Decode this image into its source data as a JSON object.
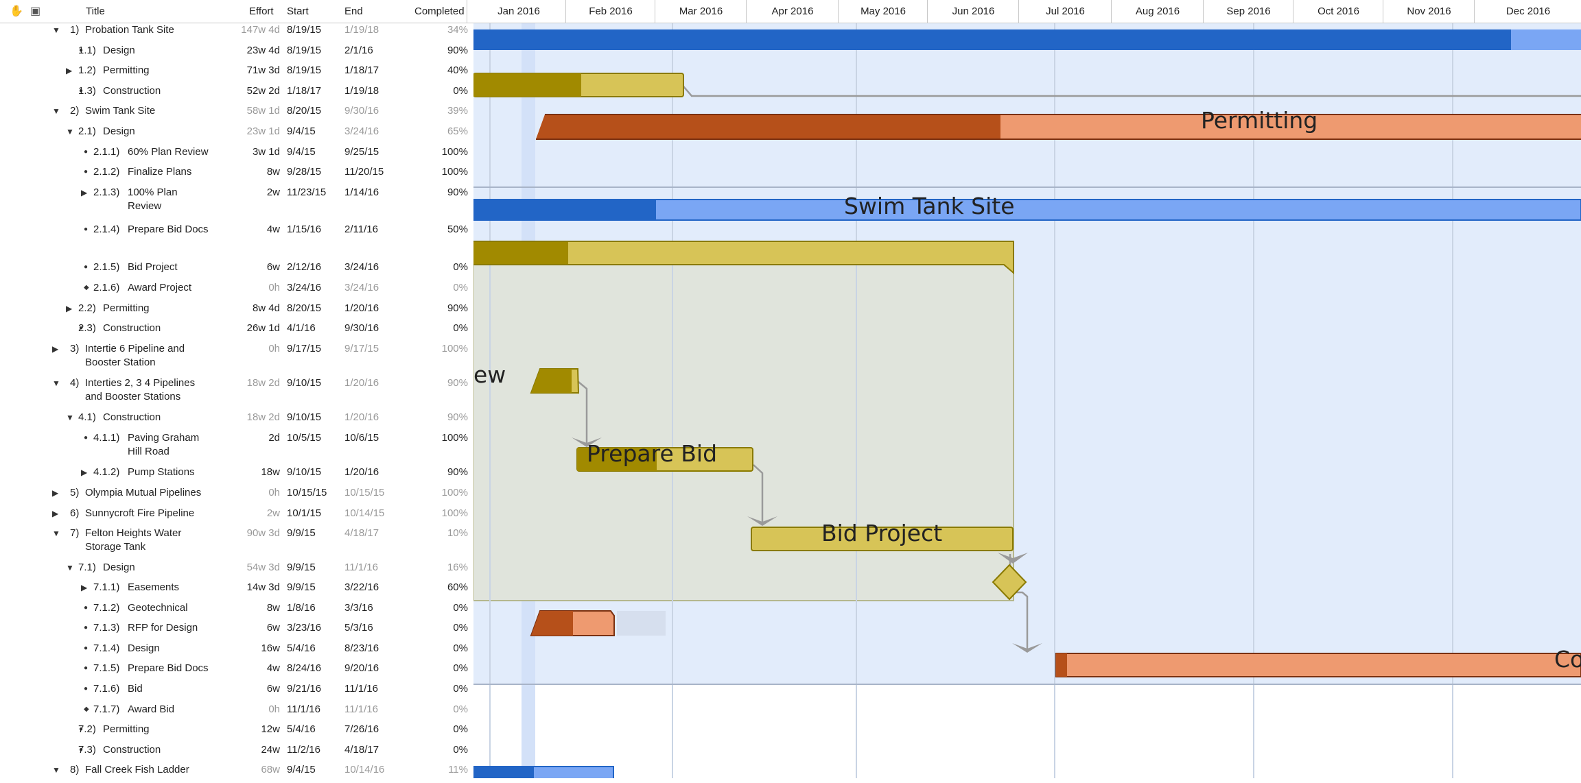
{
  "toolbar": {
    "hand_icon": "✋",
    "grid_icon": "▣"
  },
  "columns": {
    "title": "Title",
    "effort": "Effort",
    "start": "Start",
    "end": "End",
    "completed": "Completed"
  },
  "months": [
    "Jan 2016",
    "Feb 2016",
    "Mar 2016",
    "Apr 2016",
    "May 2016",
    "Jun 2016",
    "Jul 2016",
    "Aug 2016",
    "Sep 2016",
    "Oct 2016",
    "Nov 2016",
    "Dec 2016"
  ],
  "rows": [
    {
      "level": 0,
      "marker": "open",
      "num": "1)",
      "title": "Probation Tank Site",
      "effort": "147w 4d",
      "start": "8/19/15",
      "end": "1/19/18",
      "completed": "34%",
      "dim": true
    },
    {
      "level": 1,
      "marker": "bullet",
      "num": "1.1)",
      "title": "Design",
      "effort": "23w 4d",
      "start": "8/19/15",
      "end": "2/1/16",
      "completed": "90%"
    },
    {
      "level": 1,
      "marker": "closed",
      "num": "1.2)",
      "title": "Permitting",
      "effort": "71w 3d",
      "start": "8/19/15",
      "end": "1/18/17",
      "completed": "40%"
    },
    {
      "level": 1,
      "marker": "bullet",
      "num": "1.3)",
      "title": "Construction",
      "effort": "52w 2d",
      "start": "1/18/17",
      "end": "1/19/18",
      "completed": "0%"
    },
    {
      "level": 0,
      "marker": "open",
      "num": "2)",
      "title": "Swim Tank Site",
      "effort": "58w 1d",
      "start": "8/20/15",
      "end": "9/30/16",
      "completed": "39%",
      "dim": true
    },
    {
      "level": 1,
      "marker": "open",
      "num": "2.1)",
      "title": "Design",
      "effort": "23w 1d",
      "start": "9/4/15",
      "end": "3/24/16",
      "completed": "65%",
      "dim": true
    },
    {
      "level": 2,
      "marker": "bullet",
      "num": "2.1.1)",
      "title": "60% Plan Review",
      "effort": "3w 1d",
      "start": "9/4/15",
      "end": "9/25/15",
      "completed": "100%"
    },
    {
      "level": 2,
      "marker": "bullet",
      "num": "2.1.2)",
      "title": "Finalize Plans",
      "effort": "8w",
      "start": "9/28/15",
      "end": "11/20/15",
      "completed": "100%"
    },
    {
      "level": 2,
      "marker": "closed",
      "num": "2.1.3)",
      "title": "100% Plan Review",
      "effort": "2w",
      "start": "11/23/15",
      "end": "1/14/16",
      "completed": "90%",
      "lines": 2
    },
    {
      "level": 2,
      "marker": "bullet",
      "num": "2.1.4)",
      "title": "Prepare Bid Docs",
      "effort": "4w",
      "start": "1/15/16",
      "end": "2/11/16",
      "completed": "50%",
      "lines": 2
    },
    {
      "level": 2,
      "marker": "bullet",
      "num": "2.1.5)",
      "title": "Bid Project",
      "effort": "6w",
      "start": "2/12/16",
      "end": "3/24/16",
      "completed": "0%"
    },
    {
      "level": 2,
      "marker": "diamond",
      "num": "2.1.6)",
      "title": "Award Project",
      "effort": "0h",
      "start": "3/24/16",
      "end": "3/24/16",
      "completed": "0%",
      "dim": true
    },
    {
      "level": 1,
      "marker": "closed",
      "num": "2.2)",
      "title": "Permitting",
      "effort": "8w 4d",
      "start": "8/20/15",
      "end": "1/20/16",
      "completed": "90%"
    },
    {
      "level": 1,
      "marker": "bullet",
      "num": "2.3)",
      "title": "Construction",
      "effort": "26w 1d",
      "start": "4/1/16",
      "end": "9/30/16",
      "completed": "0%"
    },
    {
      "level": 0,
      "marker": "closed",
      "num": "3)",
      "title": "Intertie 6 Pipeline and Booster Station",
      "effort": "0h",
      "start": "9/17/15",
      "end": "9/17/15",
      "completed": "100%",
      "dim": true,
      "lines": 2
    },
    {
      "level": 0,
      "marker": "open",
      "num": "4)",
      "title": "Interties 2, 3 4 Pipelines and Booster Stations",
      "effort": "18w 2d",
      "start": "9/10/15",
      "end": "1/20/16",
      "completed": "90%",
      "dim": true,
      "lines": 2
    },
    {
      "level": 1,
      "marker": "open",
      "num": "4.1)",
      "title": "Construction",
      "effort": "18w 2d",
      "start": "9/10/15",
      "end": "1/20/16",
      "completed": "90%",
      "dim": true
    },
    {
      "level": 2,
      "marker": "bullet",
      "num": "4.1.1)",
      "title": "Paving Graham Hill Road",
      "effort": "2d",
      "start": "10/5/15",
      "end": "10/6/15",
      "completed": "100%",
      "lines": 2
    },
    {
      "level": 2,
      "marker": "closed",
      "num": "4.1.2)",
      "title": "Pump Stations",
      "effort": "18w",
      "start": "9/10/15",
      "end": "1/20/16",
      "completed": "90%"
    },
    {
      "level": 0,
      "marker": "closed",
      "num": "5)",
      "title": "Olympia Mutual Pipelines",
      "effort": "0h",
      "start": "10/15/15",
      "end": "10/15/15",
      "completed": "100%",
      "dim": true
    },
    {
      "level": 0,
      "marker": "closed",
      "num": "6)",
      "title": "Sunnycroft Fire Pipeline",
      "effort": "2w",
      "start": "10/1/15",
      "end": "10/14/15",
      "completed": "100%",
      "dim": true
    },
    {
      "level": 0,
      "marker": "open",
      "num": "7)",
      "title": "Felton Heights Water Storage Tank",
      "effort": "90w 3d",
      "start": "9/9/15",
      "end": "4/18/17",
      "completed": "10%",
      "dim": true,
      "lines": 2
    },
    {
      "level": 1,
      "marker": "open",
      "num": "7.1)",
      "title": "Design",
      "effort": "54w 3d",
      "start": "9/9/15",
      "end": "11/1/16",
      "completed": "16%",
      "dim": true
    },
    {
      "level": 2,
      "marker": "closed",
      "num": "7.1.1)",
      "title": "Easements",
      "effort": "14w 3d",
      "start": "9/9/15",
      "end": "3/22/16",
      "completed": "60%"
    },
    {
      "level": 2,
      "marker": "bullet",
      "num": "7.1.2)",
      "title": "Geotechnical",
      "effort": "8w",
      "start": "1/8/16",
      "end": "3/3/16",
      "completed": "0%"
    },
    {
      "level": 2,
      "marker": "bullet",
      "num": "7.1.3)",
      "title": "RFP for Design",
      "effort": "6w",
      "start": "3/23/16",
      "end": "5/3/16",
      "completed": "0%"
    },
    {
      "level": 2,
      "marker": "bullet",
      "num": "7.1.4)",
      "title": "Design",
      "effort": "16w",
      "start": "5/4/16",
      "end": "8/23/16",
      "completed": "0%"
    },
    {
      "level": 2,
      "marker": "bullet",
      "num": "7.1.5)",
      "title": "Prepare Bid Docs",
      "effort": "4w",
      "start": "8/24/16",
      "end": "9/20/16",
      "completed": "0%"
    },
    {
      "level": 2,
      "marker": "bullet",
      "num": "7.1.6)",
      "title": "Bid",
      "effort": "6w",
      "start": "9/21/16",
      "end": "11/1/16",
      "completed": "0%"
    },
    {
      "level": 2,
      "marker": "diamond",
      "num": "7.1.7)",
      "title": "Award Bid",
      "effort": "0h",
      "start": "11/1/16",
      "end": "11/1/16",
      "completed": "0%",
      "dim": true
    },
    {
      "level": 1,
      "marker": "bullet",
      "num": "7.2)",
      "title": "Permitting",
      "effort": "12w",
      "start": "5/4/16",
      "end": "7/26/16",
      "completed": "0%"
    },
    {
      "level": 1,
      "marker": "bullet",
      "num": "7.3)",
      "title": "Construction",
      "effort": "24w",
      "start": "11/2/16",
      "end": "4/18/17",
      "completed": "0%"
    },
    {
      "level": 0,
      "marker": "open",
      "num": "8)",
      "title": "Fall Creek Fish Ladder",
      "effort": "68w",
      "start": "9/4/15",
      "end": "10/14/16",
      "completed": "11%",
      "dim": true
    }
  ],
  "bar_labels": {
    "permitting": "Permitting",
    "swim_tank": "Swim Tank Site",
    "plan_review_partial": "ew",
    "prepare_bid": "Prepare Bid",
    "bid_project": "Bid Project",
    "construction_partial": "Co"
  },
  "colors": {
    "blue_dark": "#2265c6",
    "blue_light": "#7aa6f4",
    "gold_dark": "#a18a00",
    "gold_light": "#d7c457",
    "orange_dark": "#b6501a",
    "orange_light": "#ee9a70",
    "region_blue": "#e2ecfb",
    "region_gray": "#e0e4dc"
  }
}
